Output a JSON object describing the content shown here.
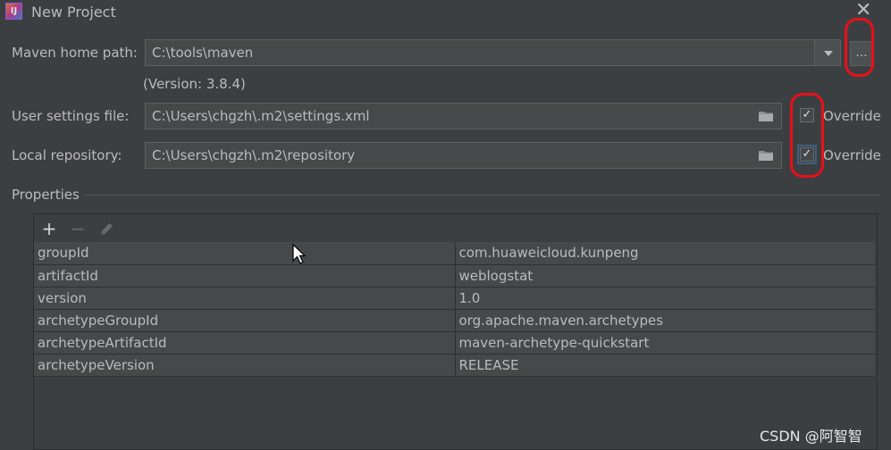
{
  "window": {
    "title": "New Project",
    "close_glyph": "✕"
  },
  "maven_home": {
    "label": "Maven home path:",
    "value": "C:\\tools\\maven",
    "browse_label": "...",
    "version_note": "(Version: 3.8.4)"
  },
  "user_settings": {
    "label": "User settings file:",
    "value": "C:\\Users\\chgzh\\.m2\\settings.xml",
    "override_label": "Override",
    "override_checked": true
  },
  "local_repo": {
    "label": "Local repository:",
    "value": "C:\\Users\\chgzh\\.m2\\repository",
    "override_label": "Override",
    "override_checked": true
  },
  "properties": {
    "title": "Properties",
    "toolbar": {
      "add_glyph": "+",
      "remove_glyph": "−",
      "edit_icon": "pencil-icon"
    },
    "rows": [
      {
        "key": "groupId",
        "value": "com.huaweicloud.kunpeng"
      },
      {
        "key": "artifactId",
        "value": "weblogstat"
      },
      {
        "key": "version",
        "value": "1.0"
      },
      {
        "key": "archetypeGroupId",
        "value": "org.apache.maven.archetypes"
      },
      {
        "key": "archetypeArtifactId",
        "value": "maven-archetype-quickstart"
      },
      {
        "key": "archetypeVersion",
        "value": "RELEASE"
      }
    ]
  },
  "watermark": "CSDN @阿智智",
  "colors": {
    "background": "#3c3f41",
    "field": "#45494a",
    "text": "#bbbbbb",
    "annotation": "#e8101a"
  }
}
